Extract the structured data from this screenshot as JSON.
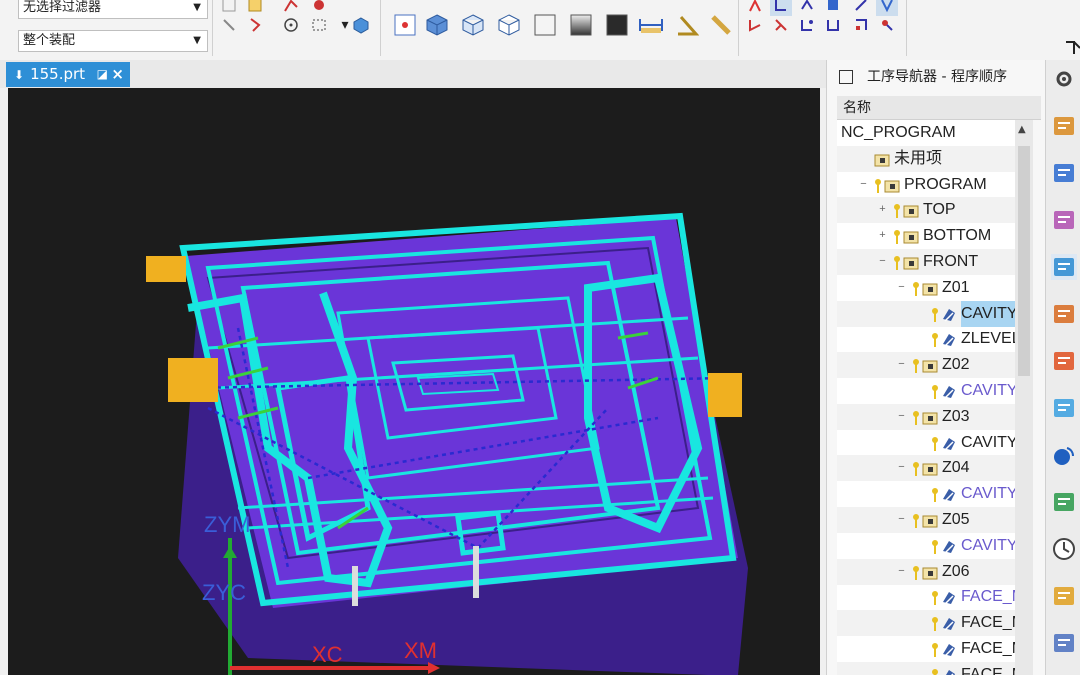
{
  "toolbar": {
    "filter_combo": "无选择过滤器",
    "scope_combo": "整个装配",
    "icons": [
      "select-icon",
      "snap-point-icon",
      "rectangle-select-icon",
      "solid-cube-icon",
      "fit-view-icon",
      "shaded-cube-icon",
      "wireframe-cube-icon",
      "hidden-line-cube-icon",
      "light-background-icon",
      "gradient-background-icon",
      "dark-background-icon",
      "measure-distance-icon",
      "measure-angle-icon",
      "ruler-icon",
      "tree-view-icons"
    ]
  },
  "file_tab": {
    "label": "155.prt"
  },
  "viewport": {
    "wcs_y": "ZYM",
    "wcs_z": "ZYC",
    "wcs_xc": "XC",
    "wcs_xm": "XM",
    "colors": {
      "background": "#1c1c1c",
      "part": "#6a35d8",
      "toolpath": "#19e6e0",
      "rapid": "#2a2ad0"
    }
  },
  "navigator": {
    "title": "工序导航器 - 程序顺序",
    "column_header": "名称",
    "rows": [
      {
        "label": "NC_PROGRAM",
        "depth": 0,
        "type": "root"
      },
      {
        "label": "未用项",
        "depth": 1,
        "type": "folder"
      },
      {
        "label": "PROGRAM",
        "depth": 1,
        "type": "program",
        "toggle": "−"
      },
      {
        "label": "TOP",
        "depth": 2,
        "type": "program",
        "toggle": "+"
      },
      {
        "label": "BOTTOM",
        "depth": 2,
        "type": "program",
        "toggle": "+"
      },
      {
        "label": "FRONT",
        "depth": 2,
        "type": "program",
        "toggle": "−"
      },
      {
        "label": "Z01",
        "depth": 3,
        "type": "program",
        "toggle": "−"
      },
      {
        "label": "CAVITY_",
        "depth": 4,
        "type": "op",
        "selected": true
      },
      {
        "label": "ZLEVEL_",
        "depth": 4,
        "type": "op"
      },
      {
        "label": "Z02",
        "depth": 3,
        "type": "program",
        "toggle": "−"
      },
      {
        "label": "CAVITY_",
        "depth": 4,
        "type": "op",
        "purple": true
      },
      {
        "label": "Z03",
        "depth": 3,
        "type": "program",
        "toggle": "−"
      },
      {
        "label": "CAVITY_",
        "depth": 4,
        "type": "op"
      },
      {
        "label": "Z04",
        "depth": 3,
        "type": "program",
        "toggle": "−"
      },
      {
        "label": "CAVITY_",
        "depth": 4,
        "type": "op",
        "purple": true
      },
      {
        "label": "Z05",
        "depth": 3,
        "type": "program",
        "toggle": "−"
      },
      {
        "label": "CAVITY_",
        "depth": 4,
        "type": "op",
        "purple": true
      },
      {
        "label": "Z06",
        "depth": 3,
        "type": "program",
        "toggle": "−"
      },
      {
        "label": "FACE_M",
        "depth": 4,
        "type": "op",
        "purple": true
      },
      {
        "label": "FACE_M",
        "depth": 4,
        "type": "op"
      },
      {
        "label": "FACE_M",
        "depth": 4,
        "type": "op"
      },
      {
        "label": "FACE_M",
        "depth": 4,
        "type": "op"
      }
    ]
  },
  "rail": {
    "icons": [
      "settings-icon",
      "assembly-navigator-icon",
      "constraint-navigator-icon",
      "part-navigator-icon",
      "operation-navigator-icon",
      "machine-tool-icon",
      "reuse-library-icon",
      "color-palette-icon",
      "web-browser-icon",
      "document-icon",
      "history-icon",
      "simulation-icon",
      "chart-icon"
    ]
  }
}
